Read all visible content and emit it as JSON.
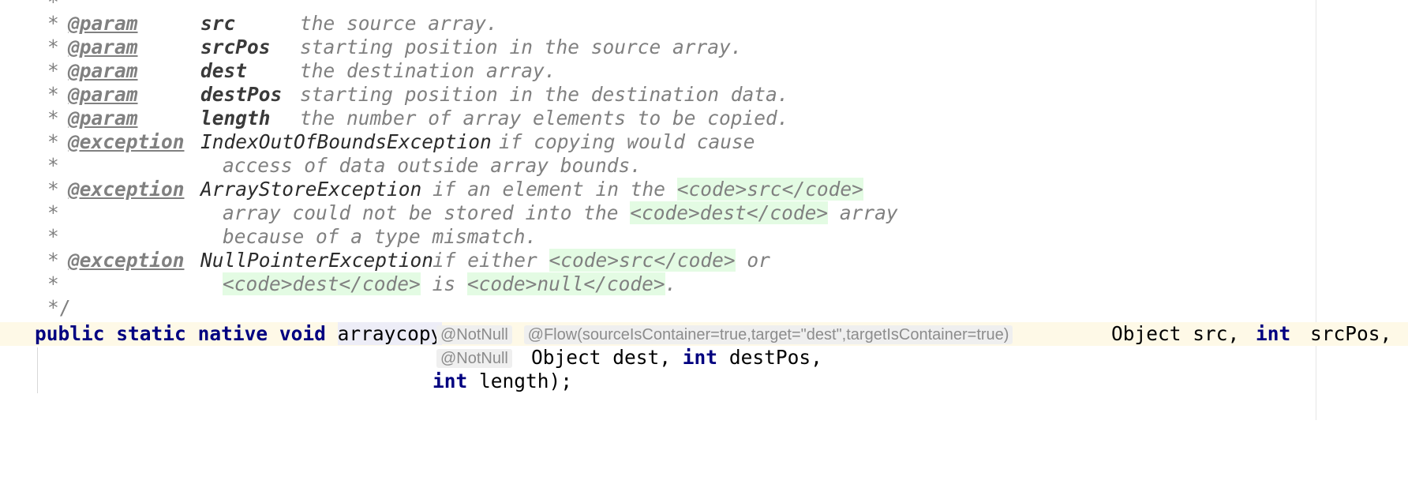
{
  "doc": {
    "star": "*",
    "star_top": "*",
    "close": "*/",
    "params": [
      {
        "tag": "@param",
        "name": "src",
        "desc": "the source array."
      },
      {
        "tag": "@param",
        "name": "srcPos",
        "desc": "starting position in the source array."
      },
      {
        "tag": "@param",
        "name": "dest",
        "desc": "the destination array."
      },
      {
        "tag": "@param",
        "name": "destPos",
        "desc": "starting position in the destination data."
      },
      {
        "tag": "@param",
        "name": "length",
        "desc": "the number of array elements to be copied."
      }
    ],
    "ex1": {
      "tag": "@exception",
      "name": "IndexOutOfBoundsException",
      "desc": "if copying would cause",
      "cont": "access of data outside array bounds."
    },
    "ex2": {
      "tag": "@exception",
      "name": "ArrayStoreException",
      "desc1": "if an element in the",
      "code_open": "<code>",
      "code_close": "</code>",
      "src": "src",
      "desc2a": "array could not be stored into the",
      "dest": "dest",
      "desc2b": "array",
      "cont": "because of a type mismatch."
    },
    "ex3": {
      "tag": "@exception",
      "name": "NullPointerException",
      "desc1": "if either",
      "src": "src",
      "or": "or",
      "dest": "dest",
      "is": "is",
      "null": "null",
      "end": "."
    }
  },
  "code": {
    "kw_public": "public",
    "kw_static": "static",
    "kw_native": "native",
    "kw_void": "void",
    "method": "arraycopy",
    "paren_open": "(",
    "hint_notnull": "@NotNull",
    "hint_flow": "@Flow(sourceIsContainer=true,target=\"dest\",targetIsContainer=true)",
    "obj_src": "Object src,",
    "kw_int": "int",
    "src_pos": "srcPos,",
    "obj_dest": "Object dest,",
    "dest_pos": "destPos,",
    "length_end": "length);"
  }
}
